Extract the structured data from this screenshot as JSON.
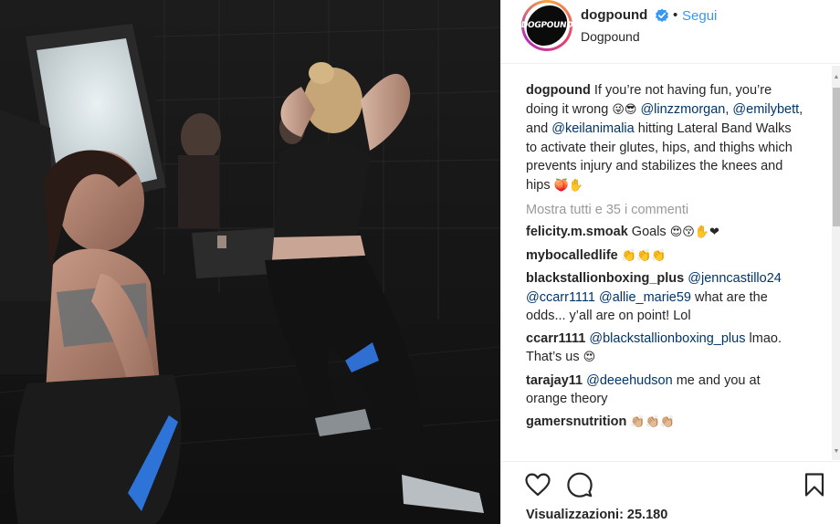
{
  "post": {
    "account": {
      "username": "dogpound",
      "avatar_text": "DOGPOUND",
      "follow_label": "Segui",
      "separator": "•",
      "location": "Dogpound",
      "verified": true
    },
    "caption": {
      "username": "dogpound",
      "text_1": "If you’re not having fun, you’re doing it wrong",
      "emoji_1": "😜😎",
      "mention_1": "@linzzmorgan",
      "sep_1": ",",
      "mention_2": "@emilybett",
      "text_2": ", and",
      "mention_3": "@keilanimalia",
      "text_3": "hitting Lateral Band Walks to activate their glutes, hips, and thighs which prevents injury and stabilizes the knees and hips",
      "emoji_2": "🍑✋"
    },
    "view_all_comments": "Mostra tutti e 35 i commenti",
    "comments": [
      {
        "username": "felicity.m.smoak",
        "text": "Goals",
        "emoji": "😍😚✋❤"
      },
      {
        "username": "mybocalledlife",
        "text": "",
        "emoji": "👏👏👏"
      },
      {
        "username": "blackstallionboxing_plus",
        "mention_a": "@jenncastillo24",
        "mention_b": "@ccarr1111",
        "mention_c": "@allie_marie59",
        "text": "what are the odds... y’all are on point! Lol"
      },
      {
        "username": "ccarr1111",
        "mention_a": "@blackstallionboxing_plus",
        "text": "lmao. That’s us",
        "emoji": "😍"
      },
      {
        "username": "tarajay11",
        "mention_a": "@deeehudson",
        "text": "me and you at orange theory"
      },
      {
        "username": "gamersnutrition",
        "text": "",
        "emoji": "👏🏼👏🏼👏🏼"
      }
    ],
    "actions": {
      "like_icon": "heart-icon",
      "comment_icon": "speech-bubble-icon",
      "save_icon": "bookmark-icon"
    },
    "views_label": "Visualizzazioni: 25.180",
    "colors": {
      "link": "#3897f0",
      "mention": "#003569",
      "muted": "#999999",
      "verified": "#3897f0"
    }
  }
}
